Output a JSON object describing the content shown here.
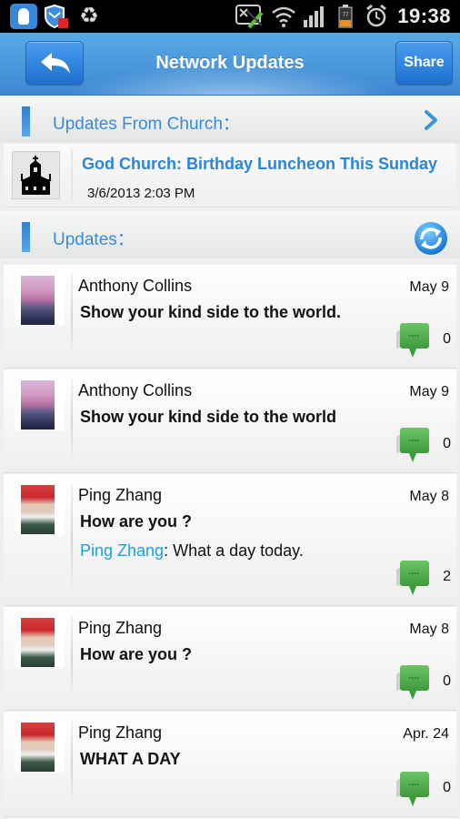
{
  "status_bar": {
    "time": "19:38",
    "battery_level": "77",
    "icons": [
      "qq-icon",
      "security-shield-icon",
      "recycle-icon",
      "missed-call-icon",
      "wifi-icon",
      "signal-icon",
      "battery-icon",
      "alarm-icon"
    ]
  },
  "header": {
    "title": "Network Updates",
    "back_icon": "back-arrow-icon",
    "share_label": "Share"
  },
  "church_section": {
    "label": "Updates From Church：",
    "chevron_icon": "chevron-right-icon",
    "item": {
      "icon": "church-icon",
      "title": "God Church: Birthday Luncheon This Sunday",
      "date": "3/6/2013 2:03 PM"
    }
  },
  "updates_section": {
    "label": "Updates：",
    "refresh_icon": "refresh-icon"
  },
  "updates": [
    {
      "author": "Anthony Collins",
      "date": "May 9",
      "message": "Show your kind side to the world.",
      "comments": "0",
      "avatar": "lake"
    },
    {
      "author": "Anthony Collins",
      "date": "May 9",
      "message": "Show your kind side to the world",
      "comments": "0",
      "avatar": "lake"
    },
    {
      "author": "Ping Zhang",
      "date": "May 8",
      "message": "How are you ?",
      "reply_author": "Ping Zhang",
      "reply_text": ": What a day today.",
      "comments": "2",
      "avatar": "baby"
    },
    {
      "author": "Ping Zhang",
      "date": "May 8",
      "message": "How are you ?",
      "comments": "0",
      "avatar": "baby"
    },
    {
      "author": "Ping Zhang",
      "date": "Apr. 24",
      "message": "WHAT A DAY",
      "comments": "0",
      "avatar": "baby"
    }
  ],
  "colors": {
    "accent_blue": "#3a8ad6",
    "link_blue": "#2d86d4",
    "reply_author": "#1ba3d9",
    "comment_green": "#4caa48",
    "title_bar": "#4a98de"
  }
}
